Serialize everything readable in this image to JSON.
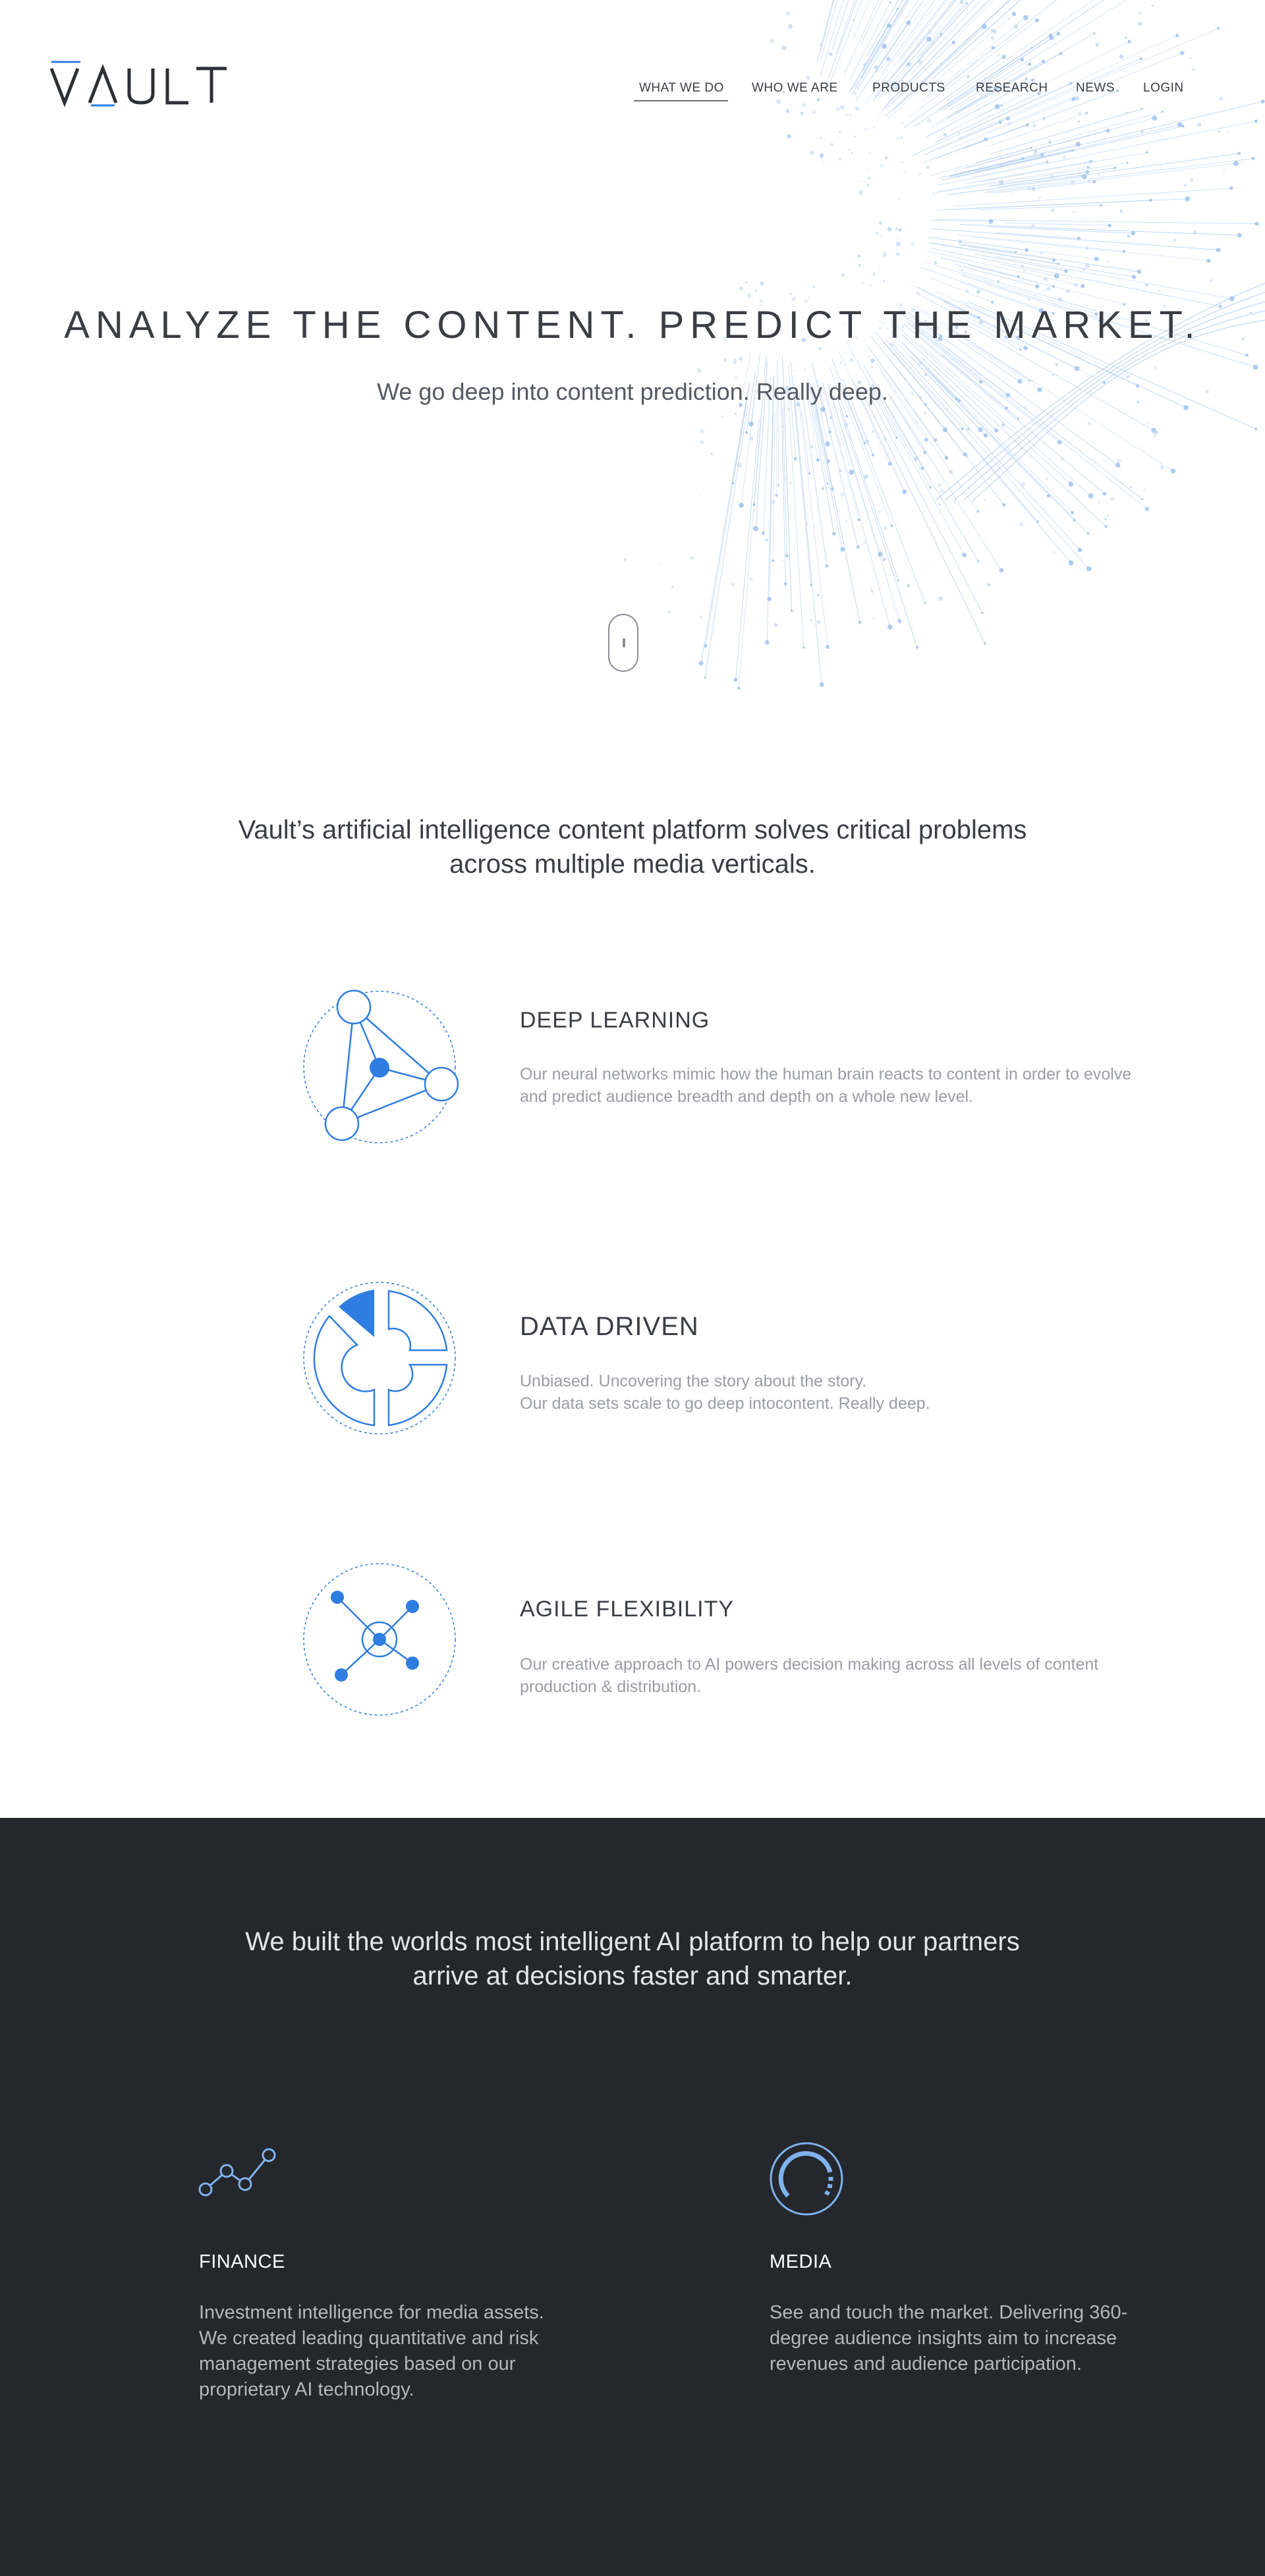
{
  "brand": {
    "logo_text": "VAULT",
    "accent": "#2f7de1"
  },
  "nav": {
    "items": [
      {
        "label": "WHAT WE DO",
        "active": true
      },
      {
        "label": "WHO WE ARE",
        "active": false
      },
      {
        "label": "PRODUCTS",
        "active": false
      },
      {
        "label": "RESEARCH",
        "active": false
      },
      {
        "label": "NEWS",
        "active": false
      },
      {
        "label": "LOGIN",
        "active": false
      }
    ]
  },
  "hero": {
    "title": "ANALYZE THE CONTENT. PREDICT THE MARKET.",
    "subtitle": "We go deep into content prediction. Really deep.",
    "scroll_icon": "mouse-scroll-icon"
  },
  "intro": {
    "text": "Vault’s artificial intelligence content platform solves critical problems across multiple media verticals."
  },
  "features": [
    {
      "icon": "network-nodes-icon",
      "title": "DEEP LEARNING",
      "description": "Our neural networks mimic how the human brain reacts to content in order to evolve and predict audience breadth and depth on a whole new level."
    },
    {
      "icon": "pie-segments-icon",
      "title": "DATA DRIVEN",
      "description_lines": [
        "Unbiased. Uncovering the story about the story.",
        "Our data sets scale to go deep intocontent. Really deep."
      ]
    },
    {
      "icon": "hub-connections-icon",
      "title": "AGILE FLEXIBILITY",
      "description": "Our creative approach to AI powers decision making across all levels of content production & distribution."
    }
  ],
  "platform": {
    "lead": "We built the worlds most intelligent AI platform to help our partners arrive at decisions faster and smarter.",
    "cards": [
      {
        "icon": "trend-line-icon",
        "title": "FINANCE",
        "description": "Investment intelligence for media assets. We created leading quantitative and risk management strategies based on our proprietary AI technology."
      },
      {
        "icon": "gauge-circle-icon",
        "title": "MEDIA",
        "description": "See and touch the market. Delivering 360-degree audience insights aim to increase revenues and audience participation."
      }
    ]
  },
  "colors": {
    "dark_bg": "#24272c",
    "icon_blue": "#2f7de1",
    "light_blue": "#7fb2ec"
  }
}
